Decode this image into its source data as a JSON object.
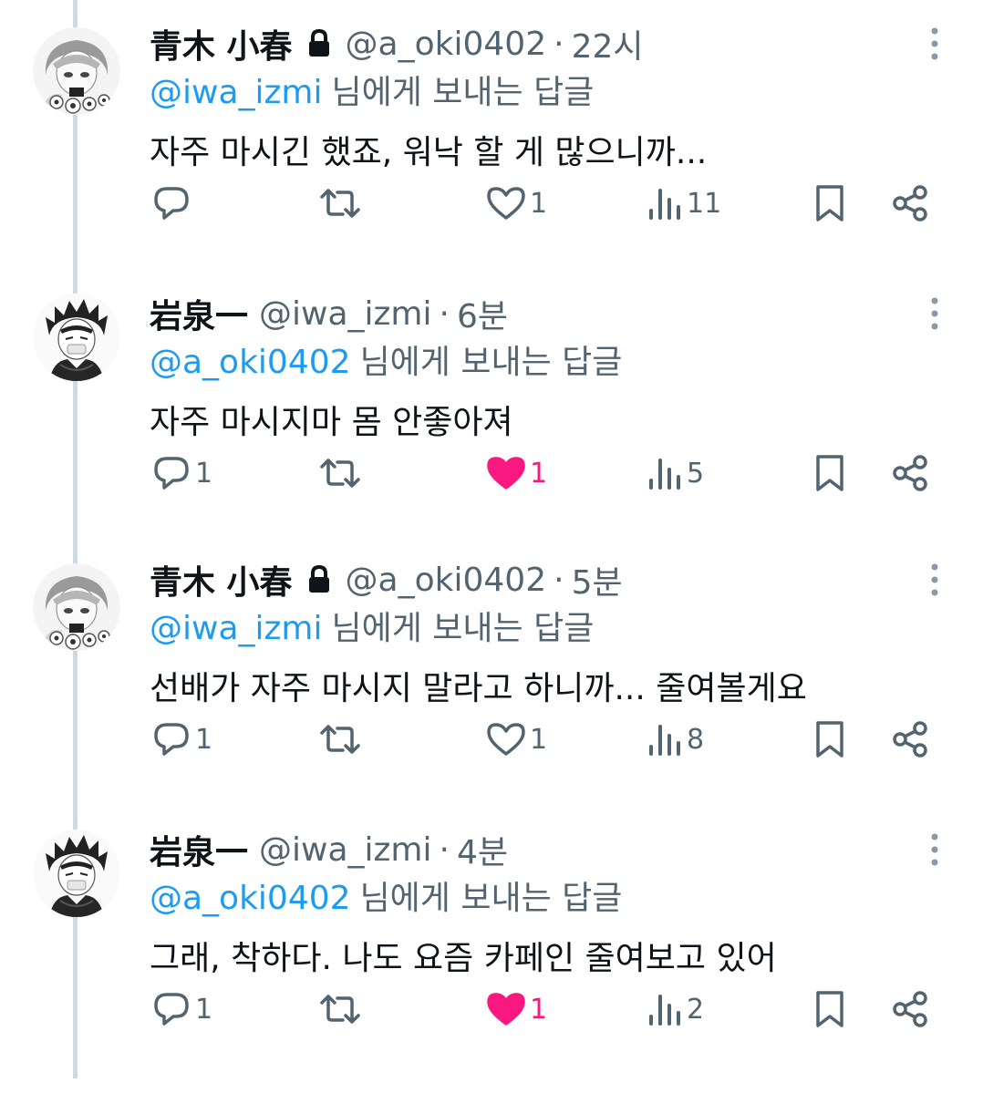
{
  "tweets": [
    {
      "name": "青木 小春",
      "locked": true,
      "handle": "@a_oki0402",
      "dot": "·",
      "time": "22시",
      "reply_to": "@iwa_izmi",
      "reply_suffix": "님에게 보내는 답글",
      "text": "자주 마시긴 했죠, 워낙 할 게 많으니까...",
      "replies": "",
      "likes": "1",
      "liked": false,
      "views": "11",
      "avatar": "girl-avatar"
    },
    {
      "name": "岩泉一",
      "locked": false,
      "handle": "@iwa_izmi",
      "dot": "·",
      "time": "6분",
      "reply_to": "@a_oki0402",
      "reply_suffix": "님에게 보내는 답글",
      "text": "자주 마시지마 몸 안좋아져",
      "replies": "1",
      "likes": "1",
      "liked": true,
      "views": "5",
      "avatar": "boy-avatar"
    },
    {
      "name": "青木 小春",
      "locked": true,
      "handle": "@a_oki0402",
      "dot": "·",
      "time": "5분",
      "reply_to": "@iwa_izmi",
      "reply_suffix": "님에게 보내는 답글",
      "text": "선배가 자주 마시지 말라고 하니까... 줄여볼게요",
      "replies": "1",
      "likes": "1",
      "liked": false,
      "views": "8",
      "avatar": "girl-avatar"
    },
    {
      "name": "岩泉一",
      "locked": false,
      "handle": "@iwa_izmi",
      "dot": "·",
      "time": "4분",
      "reply_to": "@a_oki0402",
      "reply_suffix": "님에게 보내는 답글",
      "text": "그래, 착하다. 나도 요즘 카페인 줄여보고 있어",
      "replies": "1",
      "likes": "1",
      "liked": true,
      "views": "2",
      "avatar": "boy-avatar"
    }
  ],
  "colors": {
    "link": "#1d9bf0",
    "secondary": "#536471",
    "like": "#f91880",
    "thread_line": "#cfd9de"
  },
  "icons": {
    "reply": "reply-icon",
    "retweet": "retweet-icon",
    "like": "heart-icon",
    "views": "views-icon",
    "bookmark": "bookmark-icon",
    "share": "share-icon",
    "more": "more-icon",
    "lock": "lock-icon"
  }
}
